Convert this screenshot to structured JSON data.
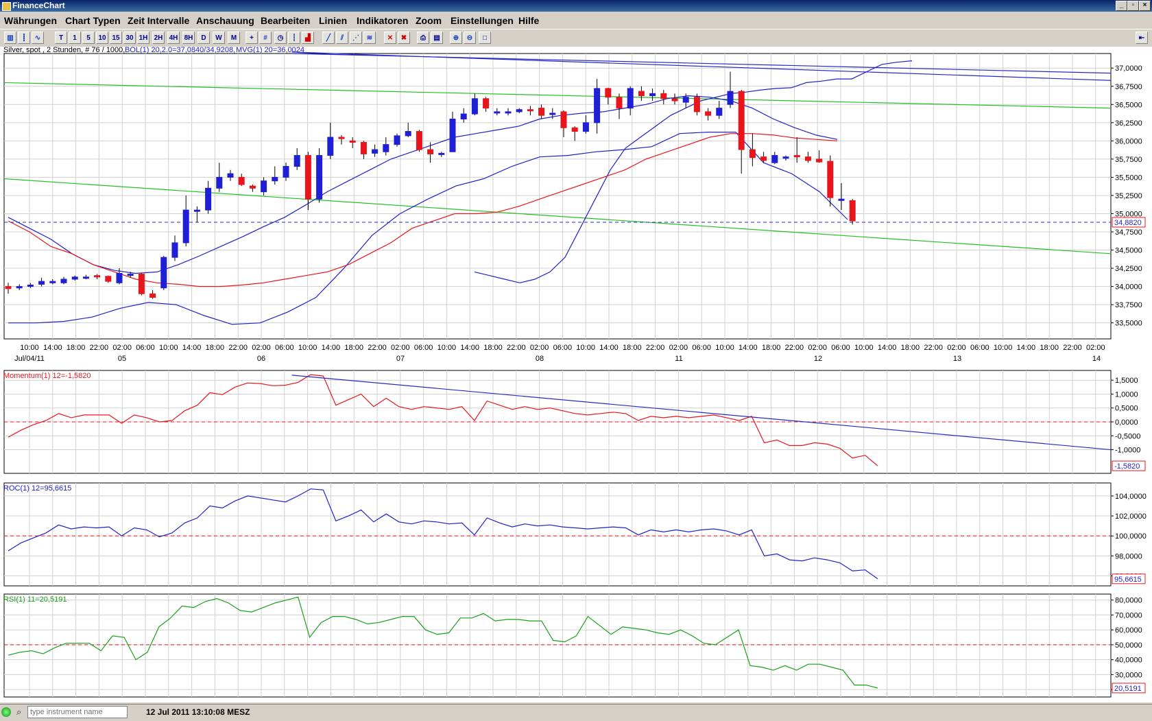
{
  "window": {
    "title": "FinanceChart"
  },
  "menu": [
    "Währungen",
    "Chart Typen",
    "Zeit Intervalle",
    "Anschauung",
    "Bearbeiten",
    "Linien",
    "Indikatoren",
    "Zoom",
    "Einstellungen",
    "Hilfe"
  ],
  "toolbar": [
    "T",
    "1",
    "5",
    "10",
    "15",
    "30",
    "1H",
    "2H",
    "4H",
    "8H",
    "D",
    "W",
    "M"
  ],
  "status": {
    "placeholder": "type instrument name",
    "datetime": "12 Jul 2011 13:10:08 MESZ"
  },
  "colors": {
    "up": "#1f1fd6",
    "down": "#e8161c",
    "bollinger": "#2020c8",
    "movavg": "#e8161c",
    "trendline_green": "#22c022",
    "trendline_blue": "#2828c8",
    "grid": "#d0d0d0",
    "rsi": "#18a018"
  },
  "chart_data": [
    {
      "type": "candlestick",
      "title": "Silver, spot , 2 Stunden, # 76 / 1000,",
      "legend": {
        "bol": "BOL(1) 20,2.0=37,0840/34,9208,",
        "bol_lower": "34,9208",
        "mvg": "MVG(1) 20=36,0024"
      },
      "yaxis": {
        "ticks": [
          "37,0000",
          "36,7500",
          "36,5000",
          "36,2500",
          "36,0000",
          "35,7500",
          "35,5000",
          "35,2500",
          "35,0000",
          "34,7500",
          "34,5000",
          "34,2500",
          "34,0000",
          "33,7500",
          "33,5000"
        ],
        "range": [
          33.28,
          37.2
        ]
      },
      "last_price_label": "34,8820",
      "xaxis": {
        "times": [
          "10:00",
          "14:00",
          "18:00",
          "22:00",
          "02:00",
          "06:00",
          "10:00",
          "14:00",
          "18:00",
          "22:00",
          "02:00",
          "06:00",
          "10:00",
          "14:00",
          "18:00",
          "22:00",
          "02:00",
          "06:00",
          "10:00",
          "14:00",
          "18:00",
          "22:00",
          "02:00",
          "06:00",
          "10:00",
          "14:00",
          "18:00",
          "22:00",
          "02:00",
          "06:00",
          "10:00",
          "14:00",
          "18:00",
          "22:00",
          "02:00",
          "06:00",
          "10:00",
          "14:00",
          "18:00",
          "22:00",
          "02:00",
          "06:00",
          "10:00",
          "14:00",
          "18:00",
          "22:00",
          "02:00"
        ],
        "dates": [
          "Jul/04/11",
          "05",
          "06",
          "07",
          "08",
          "11",
          "12",
          "13",
          "14"
        ]
      },
      "candles": [
        [
          34.0,
          33.97,
          34.05,
          33.9
        ],
        [
          33.98,
          34.0,
          34.03,
          33.95
        ],
        [
          34.0,
          34.02,
          34.05,
          33.98
        ],
        [
          34.03,
          34.07,
          34.12,
          34.0
        ],
        [
          34.05,
          34.07,
          34.1,
          34.03
        ],
        [
          34.05,
          34.1,
          34.13,
          34.03
        ],
        [
          34.1,
          34.13,
          34.15,
          34.08
        ],
        [
          34.12,
          34.13,
          34.16,
          34.1
        ],
        [
          34.15,
          34.13,
          34.17,
          34.1
        ],
        [
          34.14,
          34.07,
          34.15,
          34.05
        ],
        [
          34.05,
          34.18,
          34.25,
          34.03
        ],
        [
          34.17,
          34.17,
          34.2,
          34.12
        ],
        [
          34.17,
          33.9,
          34.18,
          33.88
        ],
        [
          33.9,
          33.85,
          33.95,
          33.83
        ],
        [
          33.98,
          34.4,
          34.42,
          33.95
        ],
        [
          34.4,
          34.6,
          34.7,
          34.35
        ],
        [
          34.6,
          35.05,
          35.25,
          34.55
        ],
        [
          35.05,
          35.05,
          35.1,
          34.88
        ],
        [
          35.05,
          35.35,
          35.45,
          35.0
        ],
        [
          35.35,
          35.5,
          35.7,
          35.3
        ],
        [
          35.5,
          35.55,
          35.6,
          35.45
        ],
        [
          35.5,
          35.4,
          35.55,
          35.38
        ],
        [
          35.38,
          35.35,
          35.4,
          35.3
        ],
        [
          35.3,
          35.45,
          35.5,
          35.25
        ],
        [
          35.45,
          35.5,
          35.65,
          35.4
        ],
        [
          35.5,
          35.65,
          35.7,
          35.45
        ],
        [
          35.65,
          35.8,
          35.9,
          35.6
        ],
        [
          35.8,
          35.2,
          35.85,
          35.05
        ],
        [
          35.2,
          35.8,
          35.9,
          35.15
        ],
        [
          35.8,
          36.05,
          36.25,
          35.75
        ],
        [
          36.05,
          36.03,
          36.08,
          35.95
        ],
        [
          36.0,
          35.98,
          36.05,
          35.9
        ],
        [
          35.98,
          35.82,
          36.0,
          35.75
        ],
        [
          35.83,
          35.88,
          35.95,
          35.78
        ],
        [
          35.85,
          35.95,
          36.05,
          35.8
        ],
        [
          35.95,
          36.07,
          36.1,
          35.92
        ],
        [
          36.07,
          36.13,
          36.25,
          36.05
        ],
        [
          36.13,
          35.88,
          36.15,
          35.85
        ],
        [
          35.88,
          35.82,
          35.98,
          35.7
        ],
        [
          35.82,
          35.83,
          35.85,
          35.78
        ],
        [
          35.85,
          36.3,
          36.4,
          35.85
        ],
        [
          36.3,
          36.37,
          36.45,
          36.25
        ],
        [
          36.37,
          36.58,
          36.65,
          36.35
        ],
        [
          36.58,
          36.45,
          36.6,
          36.4
        ],
        [
          36.4,
          36.4,
          36.45,
          36.35
        ],
        [
          36.4,
          36.4,
          36.45,
          36.35
        ],
        [
          36.4,
          36.43,
          36.45,
          36.38
        ],
        [
          36.43,
          36.42,
          36.48,
          36.35
        ],
        [
          36.45,
          36.35,
          36.5,
          36.3
        ],
        [
          36.38,
          36.38,
          36.45,
          36.3
        ],
        [
          36.4,
          36.18,
          36.42,
          36.05
        ],
        [
          36.18,
          36.13,
          36.2,
          36.0
        ],
        [
          36.13,
          36.25,
          36.35,
          36.1
        ],
        [
          36.25,
          36.72,
          36.85,
          36.1
        ],
        [
          36.72,
          36.6,
          36.73,
          36.5
        ],
        [
          36.6,
          36.45,
          36.65,
          36.3
        ],
        [
          36.45,
          36.72,
          36.75,
          36.35
        ],
        [
          36.68,
          36.62,
          36.75,
          36.55
        ],
        [
          36.62,
          36.65,
          36.72,
          36.55
        ],
        [
          36.65,
          36.58,
          36.7,
          36.5
        ],
        [
          36.58,
          36.55,
          36.65,
          36.5
        ],
        [
          36.53,
          36.6,
          36.65,
          36.45
        ],
        [
          36.6,
          36.4,
          36.65,
          36.35
        ],
        [
          36.4,
          36.35,
          36.45,
          36.28
        ],
        [
          36.35,
          36.45,
          36.55,
          36.3
        ],
        [
          36.5,
          36.68,
          36.95,
          36.45
        ],
        [
          36.68,
          35.88,
          36.7,
          35.55
        ],
        [
          35.88,
          35.77,
          36.1,
          35.65
        ],
        [
          35.78,
          35.73,
          35.85,
          35.7
        ],
        [
          35.7,
          35.8,
          35.85,
          35.68
        ],
        [
          35.78,
          35.78,
          35.8,
          35.73
        ],
        [
          35.8,
          35.78,
          36.05,
          35.7
        ],
        [
          35.78,
          35.73,
          35.85,
          35.7
        ],
        [
          35.75,
          35.71,
          35.87,
          35.7
        ],
        [
          35.72,
          35.22,
          35.8,
          35.1
        ],
        [
          35.2,
          35.2,
          35.42,
          35.05
        ],
        [
          35.18,
          34.9,
          35.2,
          34.85
        ]
      ],
      "bollinger_upper": [
        34.2,
        34.15,
        34.1,
        34.05,
        34.1,
        34.2,
        34.4,
        34.8,
        35.2,
        35.6,
        35.9,
        36.05,
        36.2,
        36.35,
        36.45,
        36.55,
        36.6,
        36.65,
        36.67,
        36.7,
        36.72,
        36.73,
        36.8,
        36.82,
        36.85,
        36.85,
        36.95,
        37.05,
        37.08,
        37.1
      ],
      "bollinger_middle": [
        34.95,
        34.8,
        34.65,
        34.45,
        34.3,
        34.22,
        34.18,
        34.2,
        34.3,
        34.42,
        34.55,
        34.68,
        34.82,
        34.95,
        35.12,
        35.3,
        35.45,
        35.6,
        35.75,
        35.85,
        35.95,
        36.05,
        36.1,
        36.15,
        36.2,
        36.3,
        36.35,
        36.38,
        36.4,
        36.45,
        36.5,
        36.58,
        36.62,
        36.6,
        36.55,
        36.45,
        36.3,
        36.18,
        36.08,
        36.02
      ],
      "bollinger_lower": [
        33.5,
        33.5,
        33.52,
        33.58,
        33.7,
        33.78,
        33.75,
        33.6,
        33.48,
        33.5,
        33.65,
        33.85,
        34.25,
        34.7,
        35.0,
        35.2,
        35.38,
        35.48,
        35.65,
        35.78,
        35.8,
        35.85,
        35.88,
        35.92,
        36.1,
        36.12,
        36.12,
        35.7,
        35.55,
        35.3,
        34.92
      ],
      "mvg": [
        34.9,
        34.75,
        34.55,
        34.45,
        34.3,
        34.2,
        34.1,
        34.05,
        34.03,
        34.0,
        34.0,
        34.02,
        34.05,
        34.1,
        34.15,
        34.2,
        34.3,
        34.45,
        34.6,
        34.8,
        34.9,
        35.0,
        35.0,
        35.02,
        35.1,
        35.2,
        35.3,
        35.4,
        35.5,
        35.6,
        35.75,
        35.85,
        35.95,
        36.05,
        36.1,
        36.1,
        36.08,
        36.04,
        36.02,
        36.0
      ],
      "trendlines": [
        {
          "color": "green",
          "from": [
            0,
            36.8
          ],
          "to": [
            1,
            36.45
          ]
        },
        {
          "color": "green",
          "from": [
            0,
            35.48
          ],
          "to": [
            1,
            34.45
          ]
        },
        {
          "color": "blue",
          "from": [
            0.26,
            37.22
          ],
          "to": [
            1,
            36.83
          ]
        },
        {
          "color": "blue",
          "from": [
            0.26,
            37.2
          ],
          "to": [
            1,
            36.93
          ]
        }
      ],
      "reference_line": 34.882
    },
    {
      "type": "line",
      "title": "Momentum(1) 12=-1,5820",
      "yaxis": {
        "ticks": [
          "1,5000",
          "1,0000",
          "0,5000",
          "0,0000",
          "-0,5000",
          "-1,0000"
        ],
        "range": [
          -1.85,
          1.85
        ]
      },
      "last_label": "-1,5820",
      "zero_line": 0,
      "values": [
        -0.55,
        -0.3,
        -0.1,
        0.05,
        0.3,
        0.15,
        0.25,
        0.25,
        0.25,
        -0.05,
        0.25,
        0.15,
        0.0,
        0.05,
        0.4,
        0.6,
        1.05,
        0.98,
        1.25,
        1.4,
        1.38,
        1.3,
        1.32,
        1.42,
        1.7,
        1.65,
        0.6,
        0.8,
        1.0,
        0.55,
        0.85,
        0.55,
        0.45,
        0.55,
        0.5,
        0.45,
        0.55,
        0.05,
        0.75,
        0.6,
        0.45,
        0.55,
        0.45,
        0.5,
        0.4,
        0.3,
        0.25,
        0.3,
        0.35,
        0.3,
        0.05,
        0.2,
        0.15,
        0.2,
        0.15,
        0.2,
        0.25,
        0.15,
        0.05,
        0.2,
        -0.75,
        -0.65,
        -0.85,
        -0.85,
        -0.75,
        -0.8,
        -0.95,
        -1.3,
        -1.2,
        -1.58
      ],
      "trendline": {
        "from": [
          0.26,
          1.68
        ],
        "to": [
          1,
          -1.0
        ]
      }
    },
    {
      "type": "line",
      "title": "ROC(1) 12=95,6615",
      "yaxis": {
        "ticks": [
          "104,0000",
          "102,0000",
          "100,0000",
          "98,0000",
          "96,0000"
        ],
        "range": [
          95.0,
          105.3
        ]
      },
      "last_label": "95,6615",
      "reference_line": 100,
      "values": [
        98.5,
        99.3,
        99.8,
        100.3,
        101.1,
        100.7,
        100.9,
        100.8,
        100.9,
        100.0,
        100.8,
        100.6,
        99.9,
        100.3,
        101.3,
        101.8,
        103.0,
        102.8,
        103.5,
        104.0,
        103.8,
        103.6,
        103.4,
        104.0,
        104.7,
        104.6,
        101.5,
        102.0,
        102.6,
        101.4,
        102.2,
        101.4,
        101.2,
        101.5,
        101.4,
        101.2,
        101.3,
        100.1,
        101.8,
        101.3,
        100.9,
        101.2,
        101.0,
        101.1,
        100.9,
        100.8,
        100.7,
        100.8,
        100.9,
        100.8,
        100.1,
        100.6,
        100.4,
        100.6,
        100.4,
        100.6,
        100.7,
        100.5,
        100.1,
        100.6,
        98.0,
        98.2,
        97.6,
        97.5,
        97.8,
        97.6,
        97.3,
        96.5,
        96.6,
        95.7
      ]
    },
    {
      "type": "line",
      "title": "RSI(1) 11=20,5191",
      "yaxis": {
        "ticks": [
          "80,0000",
          "70,0000",
          "60,0000",
          "50,0000",
          "40,0000",
          "30,0000",
          "20,0000"
        ],
        "range": [
          15,
          84
        ]
      },
      "last_label": "20,5191",
      "reference_line": 50,
      "values": [
        43,
        45,
        46,
        44,
        48,
        51,
        51,
        51,
        46,
        56,
        55,
        40,
        45,
        62,
        68,
        76,
        75,
        79,
        81,
        78,
        73,
        72,
        75,
        78,
        80,
        82,
        55,
        65,
        69,
        69,
        67,
        64,
        65,
        67,
        69,
        69,
        60,
        57,
        58,
        68,
        68,
        71,
        66,
        67,
        67,
        66,
        66,
        53,
        52,
        56,
        69,
        63,
        57,
        62,
        61,
        60,
        58,
        57,
        60,
        56,
        51,
        50,
        55,
        60,
        36,
        35,
        33,
        36,
        33,
        37,
        37,
        35,
        33,
        23,
        23,
        21
      ]
    }
  ]
}
